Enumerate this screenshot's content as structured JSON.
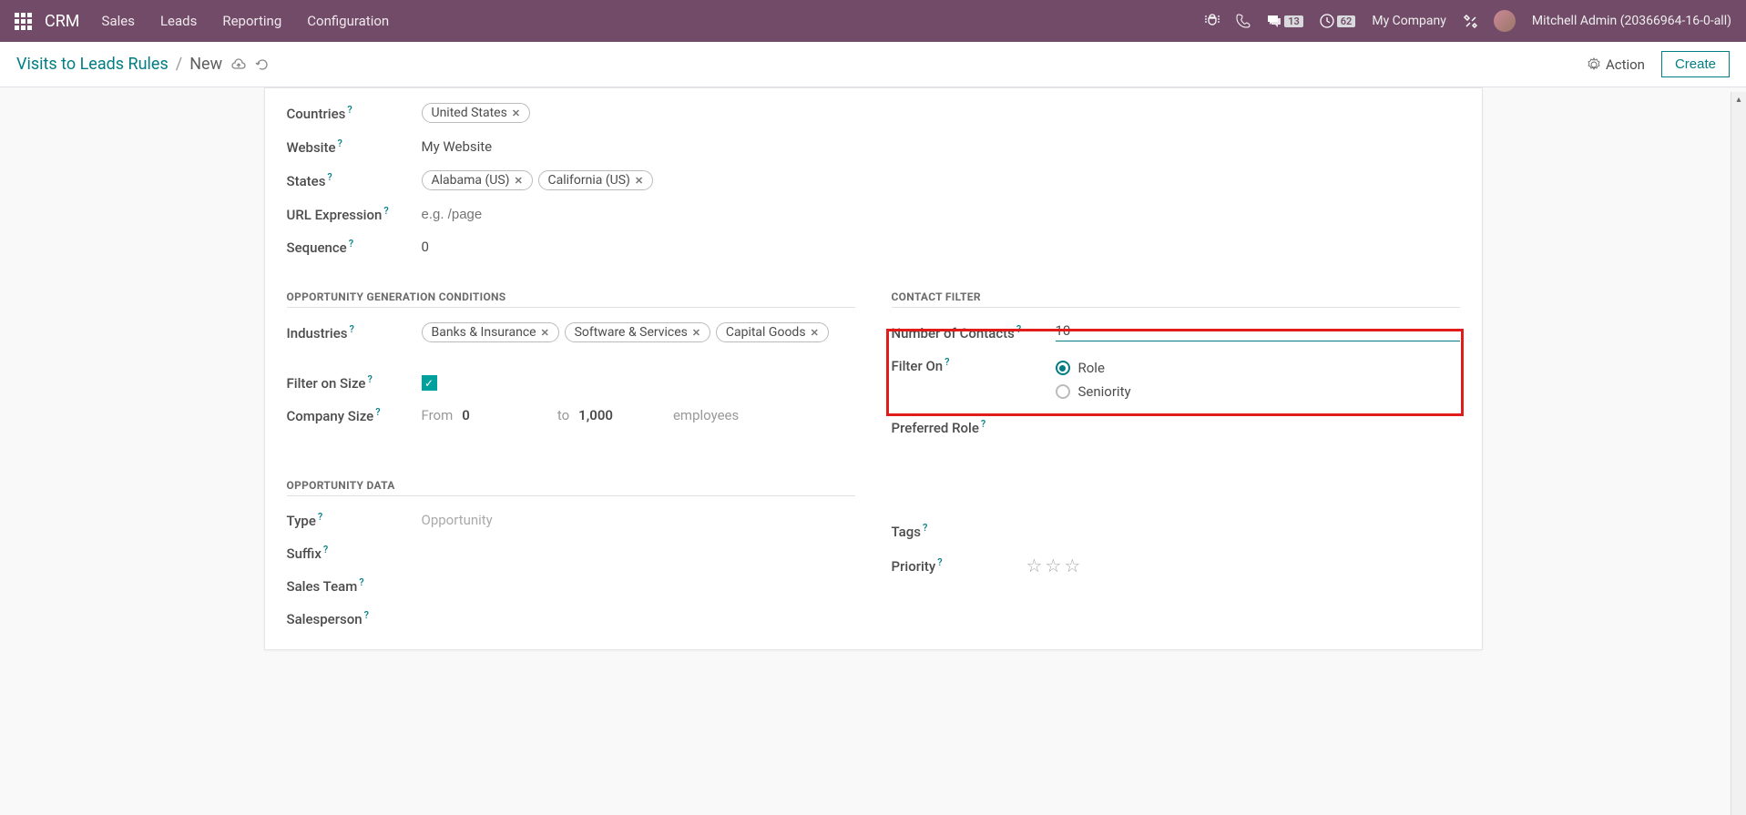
{
  "nav": {
    "brand": "CRM",
    "menu": [
      "Sales",
      "Leads",
      "Reporting",
      "Configuration"
    ],
    "company": "My Company",
    "user": "Mitchell Admin (20366964-16-0-all)",
    "messages_badge": "13",
    "activities_badge": "62"
  },
  "subbar": {
    "breadcrumb_root": "Visits to Leads Rules",
    "breadcrumb_current": "New",
    "action_label": "Action",
    "create_label": "Create"
  },
  "form": {
    "countries_label": "Countries",
    "countries": [
      "United States"
    ],
    "website_label": "Website",
    "website_value": "My Website",
    "states_label": "States",
    "states": [
      "Alabama (US)",
      "California (US)"
    ],
    "url_label": "URL Expression",
    "url_placeholder": "e.g. /page",
    "sequence_label": "Sequence",
    "sequence_value": "0",
    "section_ogc": "OPPORTUNITY GENERATION CONDITIONS",
    "industries_label": "Industries",
    "industries": [
      "Banks & Insurance",
      "Software & Services",
      "Capital Goods"
    ],
    "filter_size_label": "Filter on Size",
    "company_size_label": "Company Size",
    "size_from_label": "From",
    "size_from": "0",
    "size_to_label": "to",
    "size_to": "1,000",
    "size_unit": "employees",
    "section_contact": "CONTACT FILTER",
    "num_contacts_label": "Number of Contacts",
    "num_contacts_value": "10",
    "filter_on_label": "Filter On",
    "filter_on_options": [
      "Role",
      "Seniority"
    ],
    "preferred_role_label": "Preferred Role",
    "section_odata": "OPPORTUNITY DATA",
    "type_label": "Type",
    "type_value": "Opportunity",
    "suffix_label": "Suffix",
    "sales_team_label": "Sales Team",
    "salesperson_label": "Salesperson",
    "tags_label": "Tags",
    "priority_label": "Priority"
  }
}
